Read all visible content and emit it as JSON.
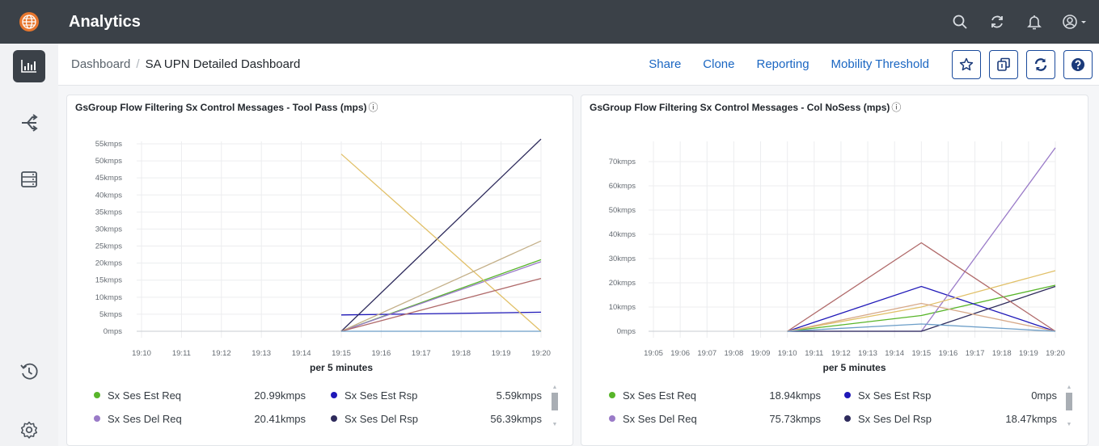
{
  "app": {
    "title": "Analytics"
  },
  "topbar": {
    "icons": [
      "search-icon",
      "refresh-icon",
      "bell-icon",
      "user-icon"
    ]
  },
  "sidebar": {
    "items": [
      "chart-icon",
      "flow-icon",
      "server-icon",
      "history-icon",
      "gear-icon"
    ]
  },
  "breadcrumb": {
    "root": "Dashboard",
    "separator": "/",
    "current": "SA UPN Detailed Dashboard"
  },
  "actions": {
    "share": "Share",
    "clone": "Clone",
    "reporting": "Reporting",
    "mobility": "Mobility Threshold"
  },
  "panels": [
    {
      "title": "GsGroup Flow Filtering Sx Control Messages - Tool Pass (mps)",
      "info": "ⓘ",
      "legend": [
        {
          "label": "Sx Ses Est Req",
          "value": "20.99kmps",
          "color": "#58b52a"
        },
        {
          "label": "Sx Ses Est Rsp",
          "value": "5.59kmps",
          "color": "#1f18b8"
        },
        {
          "label": "Sx Ses Del Req",
          "value": "20.41kmps",
          "color": "#9a7bc8"
        },
        {
          "label": "Sx Ses Del Rsp",
          "value": "56.39kmps",
          "color": "#2e2b5c"
        }
      ]
    },
    {
      "title": "GsGroup Flow Filtering Sx Control Messages - Col NoSess (mps)",
      "info": "ⓘ",
      "legend": [
        {
          "label": "Sx Ses Est Req",
          "value": "18.94kmps",
          "color": "#58b52a"
        },
        {
          "label": "Sx Ses Est Rsp",
          "value": "0mps",
          "color": "#1f18b8"
        },
        {
          "label": "Sx Ses Del Req",
          "value": "75.73kmps",
          "color": "#9a7bc8"
        },
        {
          "label": "Sx Ses Del Rsp",
          "value": "18.47kmps",
          "color": "#2e2b5c"
        }
      ]
    }
  ],
  "chart_data": [
    {
      "type": "line",
      "title": "GsGroup Flow Filtering Sx Control Messages - Tool Pass (mps)",
      "xlabel": "per 5 minutes",
      "ylabel": "",
      "x": [
        "19:10",
        "19:11",
        "19:12",
        "19:13",
        "19:14",
        "19:15",
        "19:16",
        "19:17",
        "19:18",
        "19:19",
        "19:20"
      ],
      "y_ticks": [
        "0mps",
        "5kmps",
        "10kmps",
        "15kmps",
        "20kmps",
        "25kmps",
        "30kmps",
        "35kmps",
        "40kmps",
        "45kmps",
        "50kmps",
        "55kmps"
      ],
      "ylim": [
        0,
        55
      ],
      "grid": true,
      "series": [
        {
          "name": "Sx Ses Est Req",
          "color": "#58b52a",
          "points": [
            [
              "19:15",
              0
            ],
            [
              "19:20",
              21
            ]
          ]
        },
        {
          "name": "Sx Ses Est Rsp",
          "color": "#1f18b8",
          "points": [
            [
              "19:15",
              4.8
            ],
            [
              "19:20",
              5.6
            ]
          ]
        },
        {
          "name": "Sx Ses Del Req",
          "color": "#9a7bc8",
          "points": [
            [
              "19:15",
              0
            ],
            [
              "19:20",
              20.4
            ]
          ]
        },
        {
          "name": "Sx Ses Del Rsp",
          "color": "#2e2b5c",
          "points": [
            [
              "19:15",
              0
            ],
            [
              "19:20",
              56.4
            ]
          ]
        },
        {
          "name": "",
          "color": "#e1c068",
          "points": [
            [
              "19:15",
              52
            ],
            [
              "19:20",
              0
            ]
          ]
        },
        {
          "name": "",
          "color": "#c4b089",
          "points": [
            [
              "19:15",
              0
            ],
            [
              "19:20",
              26.5
            ]
          ]
        },
        {
          "name": "",
          "color": "#b06a6a",
          "points": [
            [
              "19:15",
              0
            ],
            [
              "19:20",
              15.5
            ]
          ]
        },
        {
          "name": "",
          "color": "#6c9ec8",
          "points": [
            [
              "19:15",
              0
            ],
            [
              "19:20",
              0
            ]
          ]
        }
      ]
    },
    {
      "type": "line",
      "title": "GsGroup Flow Filtering Sx Control Messages - Col NoSess (mps)",
      "xlabel": "per 5 minutes",
      "ylabel": "",
      "x": [
        "19:05",
        "19:06",
        "19:07",
        "19:08",
        "19:09",
        "19:10",
        "19:11",
        "19:12",
        "19:13",
        "19:14",
        "19:15",
        "19:16",
        "19:17",
        "19:18",
        "19:19",
        "19:20"
      ],
      "y_ticks": [
        "0mps",
        "10kmps",
        "20kmps",
        "30kmps",
        "40kmps",
        "50kmps",
        "60kmps",
        "70kmps"
      ],
      "ylim": [
        0,
        75
      ],
      "grid": true,
      "series": [
        {
          "name": "Sx Ses Est Req",
          "color": "#58b52a",
          "points": [
            [
              "19:10",
              0
            ],
            [
              "19:15",
              6.5
            ],
            [
              "19:20",
              19
            ]
          ]
        },
        {
          "name": "Sx Ses Est Rsp",
          "color": "#1f18b8",
          "points": [
            [
              "19:10",
              0
            ],
            [
              "19:15",
              18.5
            ],
            [
              "19:20",
              0
            ]
          ]
        },
        {
          "name": "Sx Ses Del Req",
          "color": "#9a7bc8",
          "points": [
            [
              "19:10",
              0
            ],
            [
              "19:15",
              0
            ],
            [
              "19:20",
              75.7
            ]
          ]
        },
        {
          "name": "Sx Ses Del Rsp",
          "color": "#2e2b5c",
          "points": [
            [
              "19:10",
              0
            ],
            [
              "19:15",
              0
            ],
            [
              "19:20",
              18.5
            ]
          ]
        },
        {
          "name": "",
          "color": "#b06a6a",
          "points": [
            [
              "19:10",
              0
            ],
            [
              "19:15",
              36.5
            ],
            [
              "19:20",
              0
            ]
          ]
        },
        {
          "name": "",
          "color": "#e1c068",
          "points": [
            [
              "19:10",
              0
            ],
            [
              "19:15",
              10
            ],
            [
              "19:20",
              25
            ]
          ]
        },
        {
          "name": "",
          "color": "#d7a989",
          "points": [
            [
              "19:10",
              0
            ],
            [
              "19:15",
              11.5
            ],
            [
              "19:20",
              0
            ]
          ]
        },
        {
          "name": "",
          "color": "#6c9ec8",
          "points": [
            [
              "19:10",
              0
            ],
            [
              "19:15",
              3
            ],
            [
              "19:20",
              0
            ]
          ]
        }
      ]
    }
  ]
}
